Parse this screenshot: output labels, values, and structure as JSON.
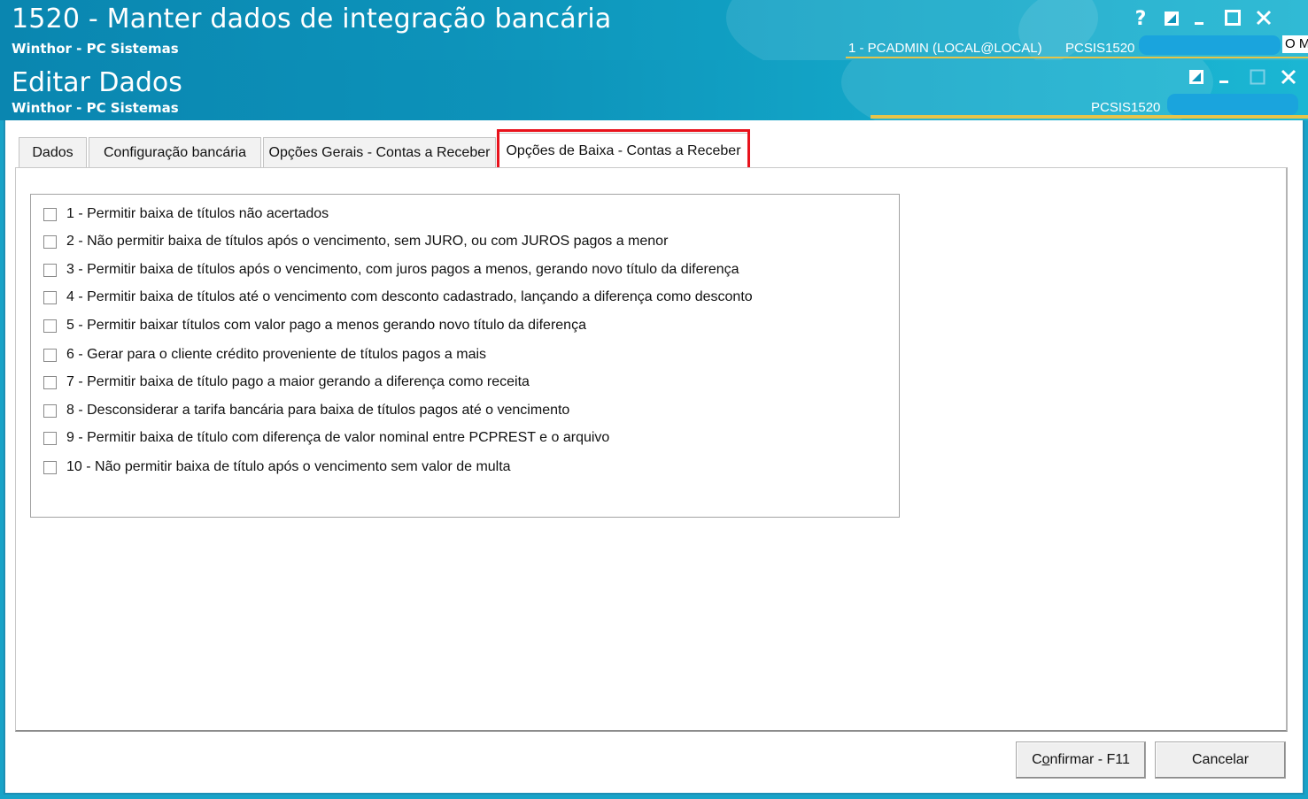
{
  "outer_window": {
    "title": "1520 - Manter dados de integração bancária",
    "subtitle": "Winthor - PC Sistemas",
    "user_info": "1 - PCADMIN (LOCAL@LOCAL)",
    "program_code": "PCSIS1520",
    "clipped_text": "O M",
    "controls": {
      "help": "?",
      "help_icon": "question-mark",
      "restore_icon": "restore-square",
      "minimize_icon": "minimize-dash",
      "maximize_icon": "maximize-square",
      "close_icon": "close-x"
    }
  },
  "dialog": {
    "title": "Editar Dados",
    "subtitle": "Winthor - PC Sistemas",
    "program_code": "PCSIS1520",
    "controls": {
      "restore_icon": "restore-square",
      "minimize_icon": "minimize-dash",
      "maximize_icon": "maximize-square-disabled",
      "close_icon": "close-x"
    }
  },
  "tabs": [
    {
      "label": "Dados",
      "active": false
    },
    {
      "label": "Configuração bancária",
      "active": false
    },
    {
      "label": "Opções Gerais - Contas a Receber",
      "active": false
    },
    {
      "label": "Opções de Baixa - Contas a Receber",
      "active": true
    }
  ],
  "options": [
    {
      "label": "1 - Permitir baixa de títulos não acertados",
      "checked": false
    },
    {
      "label": "2 - Não permitir baixa de títulos após o vencimento, sem JURO, ou com JUROS pagos a menor",
      "checked": false
    },
    {
      "label": "3 - Permitir baixa de títulos após o vencimento, com juros pagos a menos, gerando novo título da diferença",
      "checked": false
    },
    {
      "label": "4 - Permitir baixa de títulos até o vencimento com desconto cadastrado, lançando a diferença como desconto",
      "checked": false
    },
    {
      "label": "5 - Permitir baixar títulos com valor pago a menos gerando novo título da diferença",
      "checked": false
    },
    {
      "label": "6 - Gerar para o cliente crédito proveniente de títulos pagos a mais",
      "checked": false
    },
    {
      "label": "7 - Permitir baixa de título pago a maior gerando a diferença como receita",
      "checked": false
    },
    {
      "label": "8 - Desconsiderar a tarifa bancária para baixa de títulos pagos até o vencimento",
      "checked": false
    },
    {
      "label": "9 - Permitir baixa de título com diferença de valor nominal entre PCPREST e o arquivo",
      "checked": false
    },
    {
      "label": "10 - Não permitir baixa de título após o vencimento sem valor de multa",
      "checked": false
    }
  ],
  "buttons": {
    "confirm_prefix": "C",
    "confirm_mnemonic": "o",
    "confirm_suffix": "nfirmar - F11",
    "cancel": "Cancelar"
  },
  "colors": {
    "title_bar": "#0d93ba",
    "accent_line": "#e6c44a",
    "tab_highlight": "#e8121c"
  }
}
